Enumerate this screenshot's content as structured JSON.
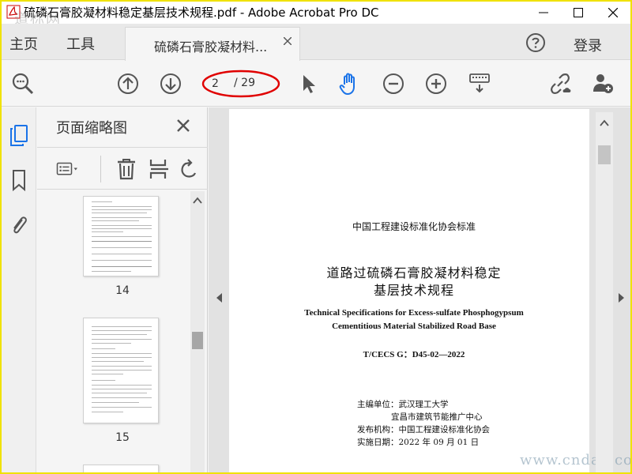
{
  "window": {
    "title": "硫磷石膏胶凝材料稳定基层技术规程.pdf - Adobe Acrobat Pro DC",
    "watermark_top": "道标网"
  },
  "menubar": {
    "home": "主页",
    "tools": "工具",
    "doc_tab": "硫磷石膏胶凝材料...",
    "login": "登录"
  },
  "toolbar": {
    "current_page": "2",
    "total_pages": "/ 29",
    "highlight_color": "#e00000",
    "hand_tool_color": "#1a73e8"
  },
  "rail": {
    "accent_color": "#1a73e8"
  },
  "panel": {
    "title": "页面缩略图",
    "thumbnails": [
      {
        "label": "14"
      },
      {
        "label": "15"
      }
    ]
  },
  "document": {
    "organization": "中国工程建设标准化协会标准",
    "title_line1": "道路过硫磷石膏胶凝材料稳定",
    "title_line2": "基层技术规程",
    "english_line1": "Technical Specifications for Excess-sulfate Phosphogypsum",
    "english_line2": "Cementitious Material Stabilized Road Base",
    "code": "T/CECS G：D45-02—2022",
    "meta": [
      "主编单位：武汉理工大学",
      "宜昌市建筑节能推广中心",
      "发布机构：中国工程建设标准化协会",
      "实施日期：2022 年 09 月 01 日"
    ],
    "watermark_bottom": "www.cndao.com"
  }
}
